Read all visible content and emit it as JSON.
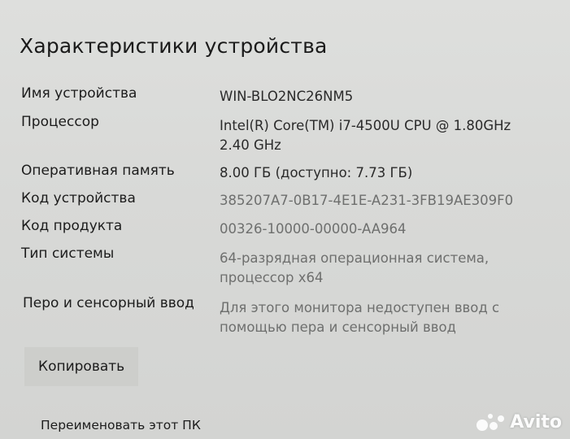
{
  "page": {
    "title": "Характеристики устройства"
  },
  "specs": [
    {
      "label": "Имя устройства",
      "value": "WIN-BLO2NC26NM5"
    },
    {
      "label": "Процессор",
      "value": "Intel(R) Core(TM) i7-4500U CPU @ 1.80GHz\n2.40 GHz"
    },
    {
      "label": "Оперативная память",
      "value": "8.00 ГБ (доступно: 7.73 ГБ)"
    },
    {
      "label": "Код устройства",
      "value": "385207A7-0B17-4E1E-A231-3FB19AE309F0"
    },
    {
      "label": "Код продукта",
      "value": "00326-10000-00000-AA964"
    },
    {
      "label": "Тип системы",
      "value": "64-разрядная операционная система, процессор x64"
    },
    {
      "label": "Перо и сенсорный ввод",
      "value": "Для этого монитора недоступен ввод с помощью пера и сенсорный ввод"
    }
  ],
  "actions": {
    "copy_label": "Копировать",
    "rename_label": "Переименовать этот ПК"
  },
  "watermark": {
    "text": "Avito",
    "icon": "avito-logo-icon"
  },
  "colors": {
    "background": "#d9dad8",
    "text": "#1e1e1e",
    "dim_text": "#6e6f6e",
    "button": "#cdcecb"
  }
}
